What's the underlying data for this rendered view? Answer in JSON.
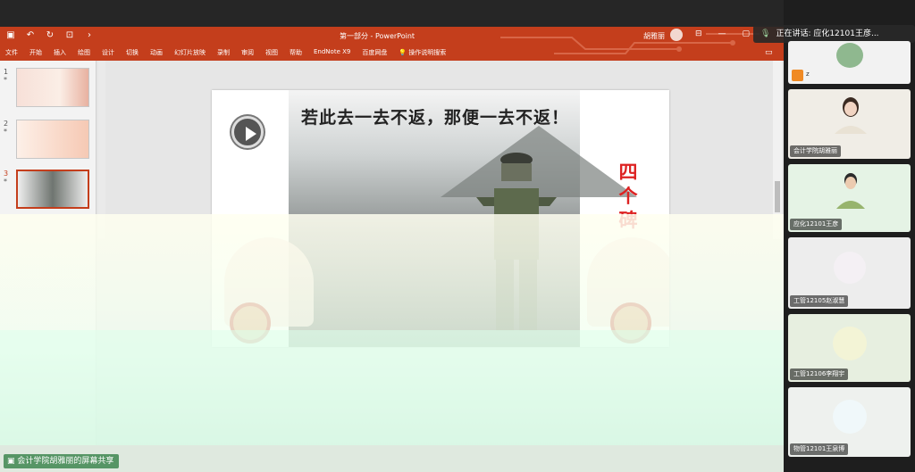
{
  "app": {
    "title": "第一部分 - PowerPoint",
    "user": "胡雅丽"
  },
  "quick_access": [
    "save",
    "undo",
    "redo",
    "presenter"
  ],
  "menu": [
    "文件",
    "开始",
    "插入",
    "绘图",
    "设计",
    "切换",
    "动画",
    "幻灯片放映",
    "录制",
    "审阅",
    "视图",
    "帮助",
    "EndNote X9",
    "百度网盘",
    "操作说明搜索"
  ],
  "thumbnails": [
    {
      "num": "1",
      "star": "*"
    },
    {
      "num": "2",
      "star": "*"
    },
    {
      "num": "3",
      "star": "*"
    }
  ],
  "slide": {
    "heading": "若此去一去不返，那便一去不返！",
    "side_text": [
      "四",
      "个",
      "碑"
    ]
  },
  "share": {
    "label": "会计学院胡雅丽的屏幕共享"
  },
  "speaking": {
    "label": "正在讲话: 应化12101王彦..."
  },
  "participants": [
    {
      "name": "z",
      "id": "t1"
    },
    {
      "name": "会计学院胡雅丽",
      "id": "t2"
    },
    {
      "name": "应化12101王彦",
      "id": "t3"
    },
    {
      "name": "工管12105赵淑慧",
      "id": "t4"
    },
    {
      "name": "工管12106李翔宇",
      "id": "t5"
    },
    {
      "name": "物管12101王泉博",
      "id": "t6"
    }
  ],
  "colors": {
    "ribbon": "#c43e1c",
    "accent_red": "#d22222"
  }
}
